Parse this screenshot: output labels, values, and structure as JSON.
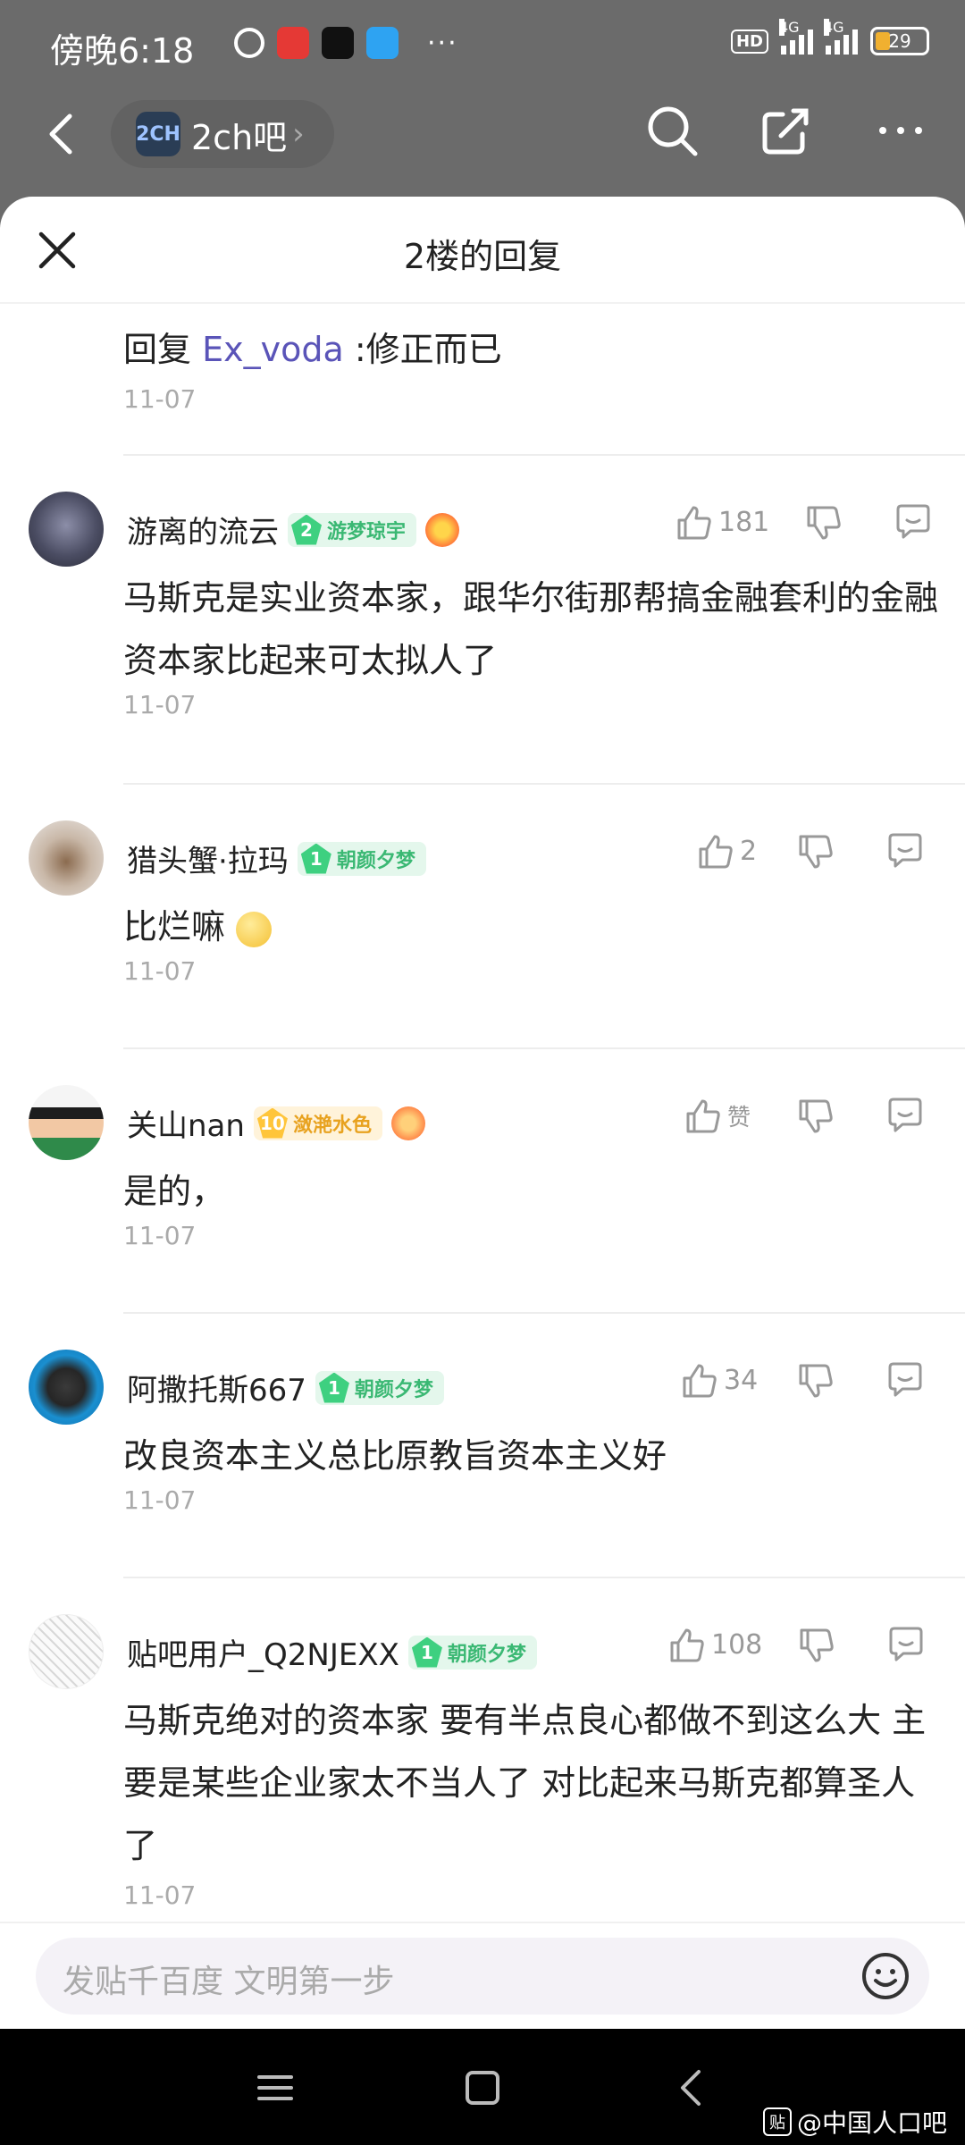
{
  "status_bar": {
    "time": "傍晚6:18",
    "battery": "29",
    "network": "4G",
    "hd": "HD",
    "more": "···"
  },
  "nav": {
    "forum_name": "2ch吧",
    "forum_icon_text": "2CH"
  },
  "sheet": {
    "title": "2楼的回复"
  },
  "previous": {
    "prefix": "回复",
    "mention": "Ex_voda",
    "text": ":修正而已",
    "date": "11-07"
  },
  "replies": [
    {
      "user": "游离的流云",
      "level": "2",
      "level_title": "游梦琼宇",
      "likes": "181",
      "text": "马斯克是实业资本家，跟华尔街那帮搞金融套利的金融资本家比起来可太拟人了",
      "date": "11-07"
    },
    {
      "user": "猎头蟹·拉玛",
      "level": "1",
      "level_title": "朝颜夕梦",
      "likes": "2",
      "text": "比烂嘛",
      "date": "11-07"
    },
    {
      "user": "关山nan",
      "level": "10",
      "level_title": "潋滟水色",
      "likes": "赞",
      "text": "是的，",
      "date": "11-07"
    },
    {
      "user": "阿撒托斯667",
      "level": "1",
      "level_title": "朝颜夕梦",
      "likes": "34",
      "text": "改良资本主义总比原教旨资本主义好",
      "date": "11-07"
    },
    {
      "user": "贴吧用户_Q2NJEXX",
      "level": "1",
      "level_title": "朝颜夕梦",
      "likes": "108",
      "text": "马斯克绝对的资本家 要有半点良心都做不到这么大 主要是某些企业家太不当人了 对比起来马斯克都算圣人了",
      "date": "11-07"
    }
  ],
  "input": {
    "placeholder": "发贴千百度 文明第一步"
  },
  "watermark": {
    "icon": "贴",
    "text": "@中国人口吧"
  }
}
